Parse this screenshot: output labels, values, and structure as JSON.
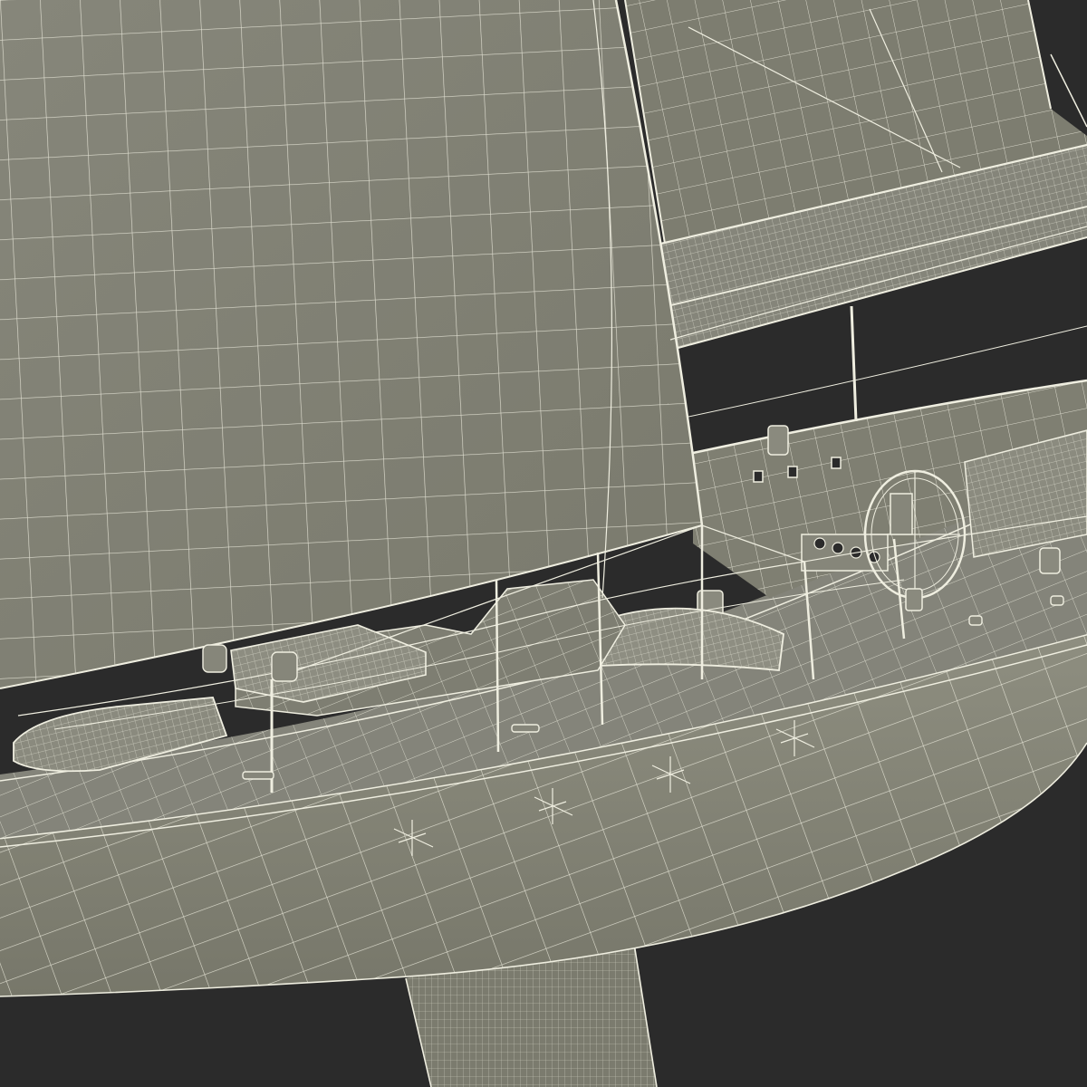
{
  "scene": {
    "subject": "sailing-yacht-wireframe-render",
    "background_color": "#2b2b2b",
    "surface_color": "#828273",
    "wire_color": "#efeee0",
    "keel_color": "#7b7b6e"
  }
}
